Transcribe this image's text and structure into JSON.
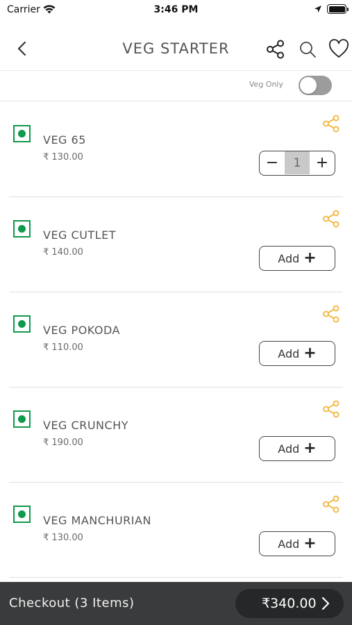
{
  "status_bar": {
    "carrier": "Carrier",
    "time": "3:46 PM",
    "icons": [
      "wifi-icon",
      "location-arrow-icon",
      "battery-icon"
    ]
  },
  "header": {
    "title": "VEG STARTER",
    "icons": [
      "back-chevron-icon",
      "share-icon",
      "search-icon",
      "heart-icon"
    ]
  },
  "filter": {
    "veg_only_label": "Veg Only",
    "veg_only_on": false
  },
  "items": [
    {
      "name": "VEG 65",
      "price": "₹ 130.00",
      "action": "stepper",
      "quantity": "1"
    },
    {
      "name": "VEG CUTLET",
      "price": "₹ 140.00",
      "action": "add",
      "add_label": "Add"
    },
    {
      "name": "VEG POKODA",
      "price": "₹ 110.00",
      "action": "add",
      "add_label": "Add"
    },
    {
      "name": "VEG CRUNCHY",
      "price": "₹ 190.00",
      "action": "add",
      "add_label": "Add"
    },
    {
      "name": "VEG MANCHURIAN",
      "price": "₹ 130.00",
      "action": "add",
      "add_label": "Add"
    }
  ],
  "stepper_symbols": {
    "minus": "−",
    "plus": "+"
  },
  "add_plus_symbol": "+",
  "checkout": {
    "label": "Checkout (3 Items)",
    "total": "₹340.00"
  },
  "colors": {
    "veg_green": "#0d9a4b",
    "share_orange": "#f2b53a",
    "checkout_bg": "#3a3b3c",
    "toggle_off": "#9c9c9c"
  }
}
